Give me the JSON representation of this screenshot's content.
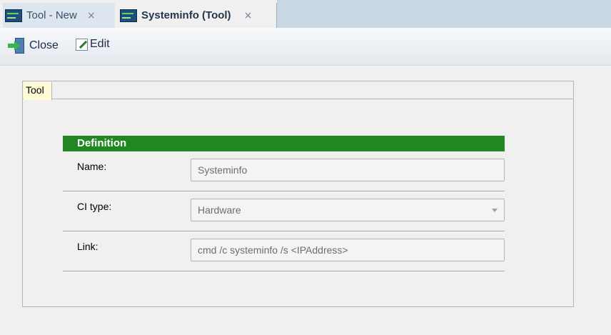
{
  "tabs": [
    {
      "label": "Tool - New",
      "close": "×"
    },
    {
      "label": "Systeminfo (Tool)",
      "close": "×"
    }
  ],
  "toolbar": {
    "close_label": "Close",
    "edit_label": "Edit"
  },
  "panel": {
    "tab_label": "Tool"
  },
  "definition": {
    "title": "Definition",
    "fields": [
      {
        "label": "Name:",
        "value": "Systeminfo"
      },
      {
        "label": "CI type:",
        "value": "Hardware"
      },
      {
        "label": "Link:",
        "value": "cmd /c systeminfo /s <IPAddress>"
      }
    ]
  },
  "colors": {
    "section_header": "#228722",
    "active_tab_bg": "#fffbd6"
  },
  "icons": {
    "tab_icon": "tool-icon",
    "close_button_icon": "exit-door-icon",
    "edit_button_icon": "edit-pencil-icon"
  }
}
